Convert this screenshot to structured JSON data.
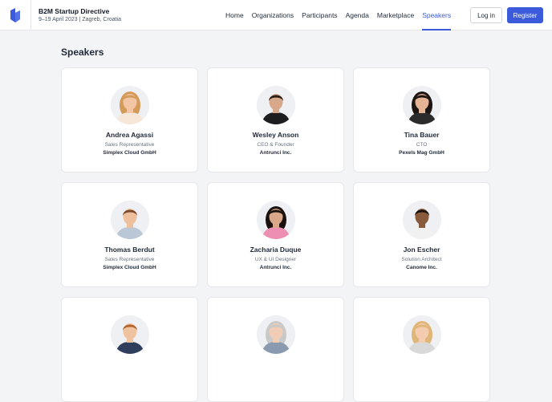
{
  "event": {
    "title": "B2M Startup Directive",
    "meta": "9–19 April 2023 | Zagreb, Croatia"
  },
  "nav": [
    {
      "label": "Home",
      "active": false
    },
    {
      "label": "Organizations",
      "active": false
    },
    {
      "label": "Participants",
      "active": false
    },
    {
      "label": "Agenda",
      "active": false
    },
    {
      "label": "Marketplace",
      "active": false
    },
    {
      "label": "Speakers",
      "active": true
    }
  ],
  "auth": {
    "login_label": "Log in",
    "register_label": "Register"
  },
  "colors": {
    "accent": "#3b5bdb"
  },
  "section_title": "Speakers",
  "speakers": [
    {
      "name": "Andrea Agassi",
      "role": "Sales Representative",
      "company": "Simplex Cloud GmbH",
      "avatar": "woman-blonde",
      "hair": "#d49a5a",
      "skin": "#f2c6a4",
      "shirt": "#f6e7d8"
    },
    {
      "name": "Wesley Anson",
      "role": "CEO & Founder",
      "company": "Antrunci Inc.",
      "avatar": "man-beard",
      "hair": "#2a1d15",
      "skin": "#d7a98a",
      "shirt": "#1d1d1f"
    },
    {
      "name": "Tina Bauer",
      "role": "CTO",
      "company": "Pexels Mag GmbH",
      "avatar": "woman-curly",
      "hair": "#1c1512",
      "skin": "#e4b495",
      "shirt": "#2b2b2b"
    },
    {
      "name": "Thomas Berdut",
      "role": "Sales Representative",
      "company": "Simplex Cloud GmbH",
      "avatar": "man-short",
      "hair": "#7a4a2a",
      "skin": "#eebf9c",
      "shirt": "#b9c7d6"
    },
    {
      "name": "Zacharia Duque",
      "role": "UX & UI Designer",
      "company": "Antrunci Inc.",
      "avatar": "woman-long-dark",
      "hair": "#1a1210",
      "skin": "#d9a888",
      "shirt": "#ec8fb3"
    },
    {
      "name": "Jon Escher",
      "role": "Solution Architect",
      "company": "Canome Inc.",
      "avatar": "man-curly",
      "hair": "#1b120d",
      "skin": "#8a5a3c",
      "shirt": "#f1f1f1"
    },
    {
      "name": "",
      "role": "",
      "company": "",
      "avatar": "man-redhair",
      "hair": "#b5652e",
      "skin": "#efc2a0",
      "shirt": "#2e3e5c"
    },
    {
      "name": "",
      "role": "",
      "company": "",
      "avatar": "woman-grey",
      "hair": "#c9c9c9",
      "skin": "#f0cdb4",
      "shirt": "#8a9bb0"
    },
    {
      "name": "",
      "role": "",
      "company": "",
      "avatar": "woman-blonde-2",
      "hair": "#e0b678",
      "skin": "#f4cdb0",
      "shirt": "#d9d9d9"
    }
  ]
}
